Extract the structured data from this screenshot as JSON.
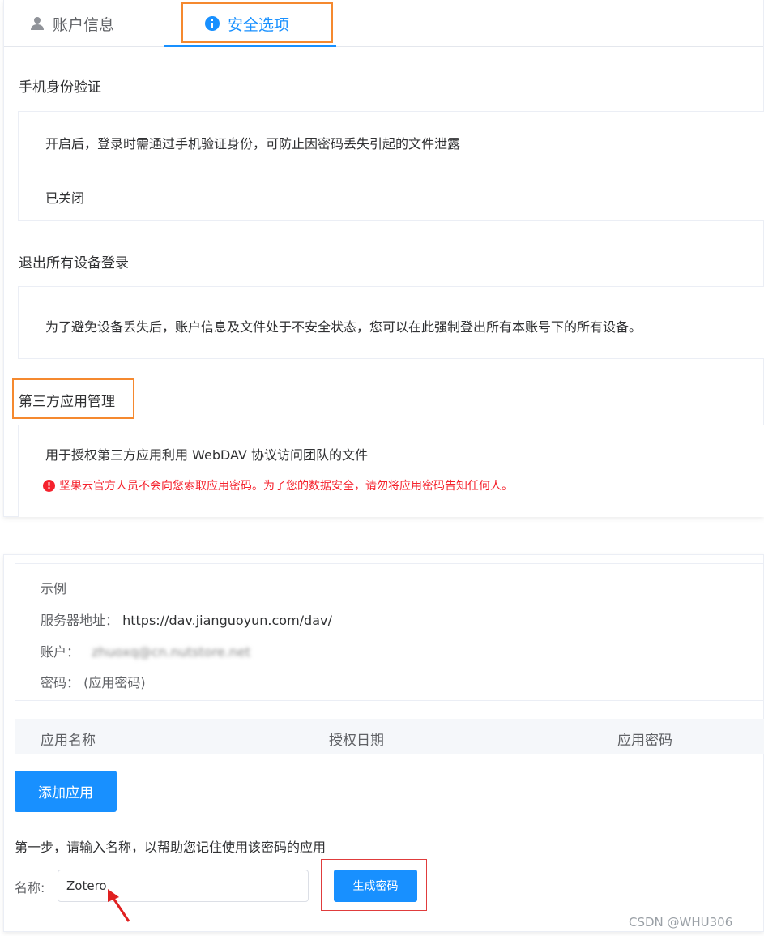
{
  "tabs": {
    "account": "账户信息",
    "security": "安全选项"
  },
  "sections": {
    "phone": {
      "title": "手机身份验证",
      "desc": "开启后，登录时需通过手机验证身份，可防止因密码丢失引起的文件泄露",
      "status": "已关闭"
    },
    "logout": {
      "title": "退出所有设备登录",
      "desc": "为了避免设备丢失后，账户信息及文件处于不安全状态，您可以在此强制登出所有本账号下的所有设备。"
    },
    "third_party": {
      "title": "第三方应用管理",
      "desc": "用于授权第三方应用利用 WebDAV 协议访问团队的文件",
      "warning": "坚果云官方人员不会向您索取应用密码。为了您的数据安全，请勿将应用密码告知任何人。"
    }
  },
  "example": {
    "heading": "示例",
    "server_label": "服务器地址：",
    "server_value": "https://dav.jianguoyun.com/dav/",
    "account_label": "账户：",
    "account_value_blurred": "zhuoxq@cn.nutstore.net",
    "password_label": "密码：",
    "password_value": "(应用密码)"
  },
  "table": {
    "col_name": "应用名称",
    "col_date": "授权日期",
    "col_password": "应用密码"
  },
  "buttons": {
    "add_app": "添加应用",
    "generate_password": "生成密码"
  },
  "form": {
    "step_text": "第一步，请输入名称，以帮助您记住使用该密码的应用",
    "name_label": "名称:",
    "name_value": "Zotero"
  },
  "watermark": "CSDN @WHU306",
  "colors": {
    "primary": "#1890ff",
    "warning": "#f5222d",
    "highlight_orange": "#f5892f",
    "highlight_red": "#e03c3c"
  }
}
